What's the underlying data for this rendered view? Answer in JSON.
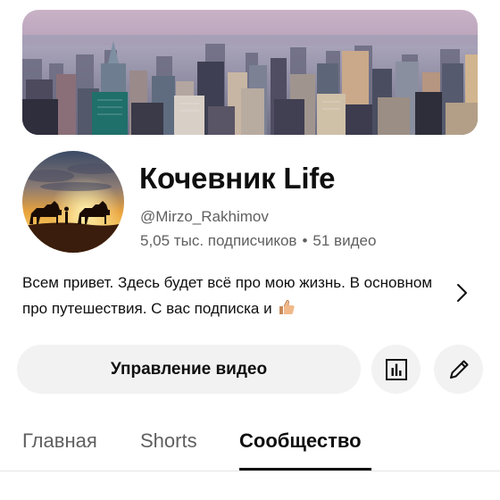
{
  "channel": {
    "name": "Кочевник Life",
    "handle": "@Mirzo_Rakhimov",
    "subscribers": "5,05 тыс. подписчиков",
    "separator": "•",
    "videos": "51 видео",
    "description": "Всем привет. Здесь будет всё про мою жизнь. В основном про путешествия. С вас подписка и"
  },
  "banner": {
    "icon": "city-skyline-banner"
  },
  "avatar": {
    "icon": "camels-sunset-avatar"
  },
  "buttons": {
    "manage_label": "Управление видео",
    "analytics_icon": "analytics-icon",
    "edit_icon": "pencil-icon"
  },
  "tabs": [
    {
      "label": "Главная",
      "active": false
    },
    {
      "label": "Shorts",
      "active": false
    },
    {
      "label": "Сообщество",
      "active": true
    }
  ],
  "colors": {
    "text_primary": "#0f0f0f",
    "text_secondary": "#606060",
    "button_bg": "#f2f2f2"
  }
}
